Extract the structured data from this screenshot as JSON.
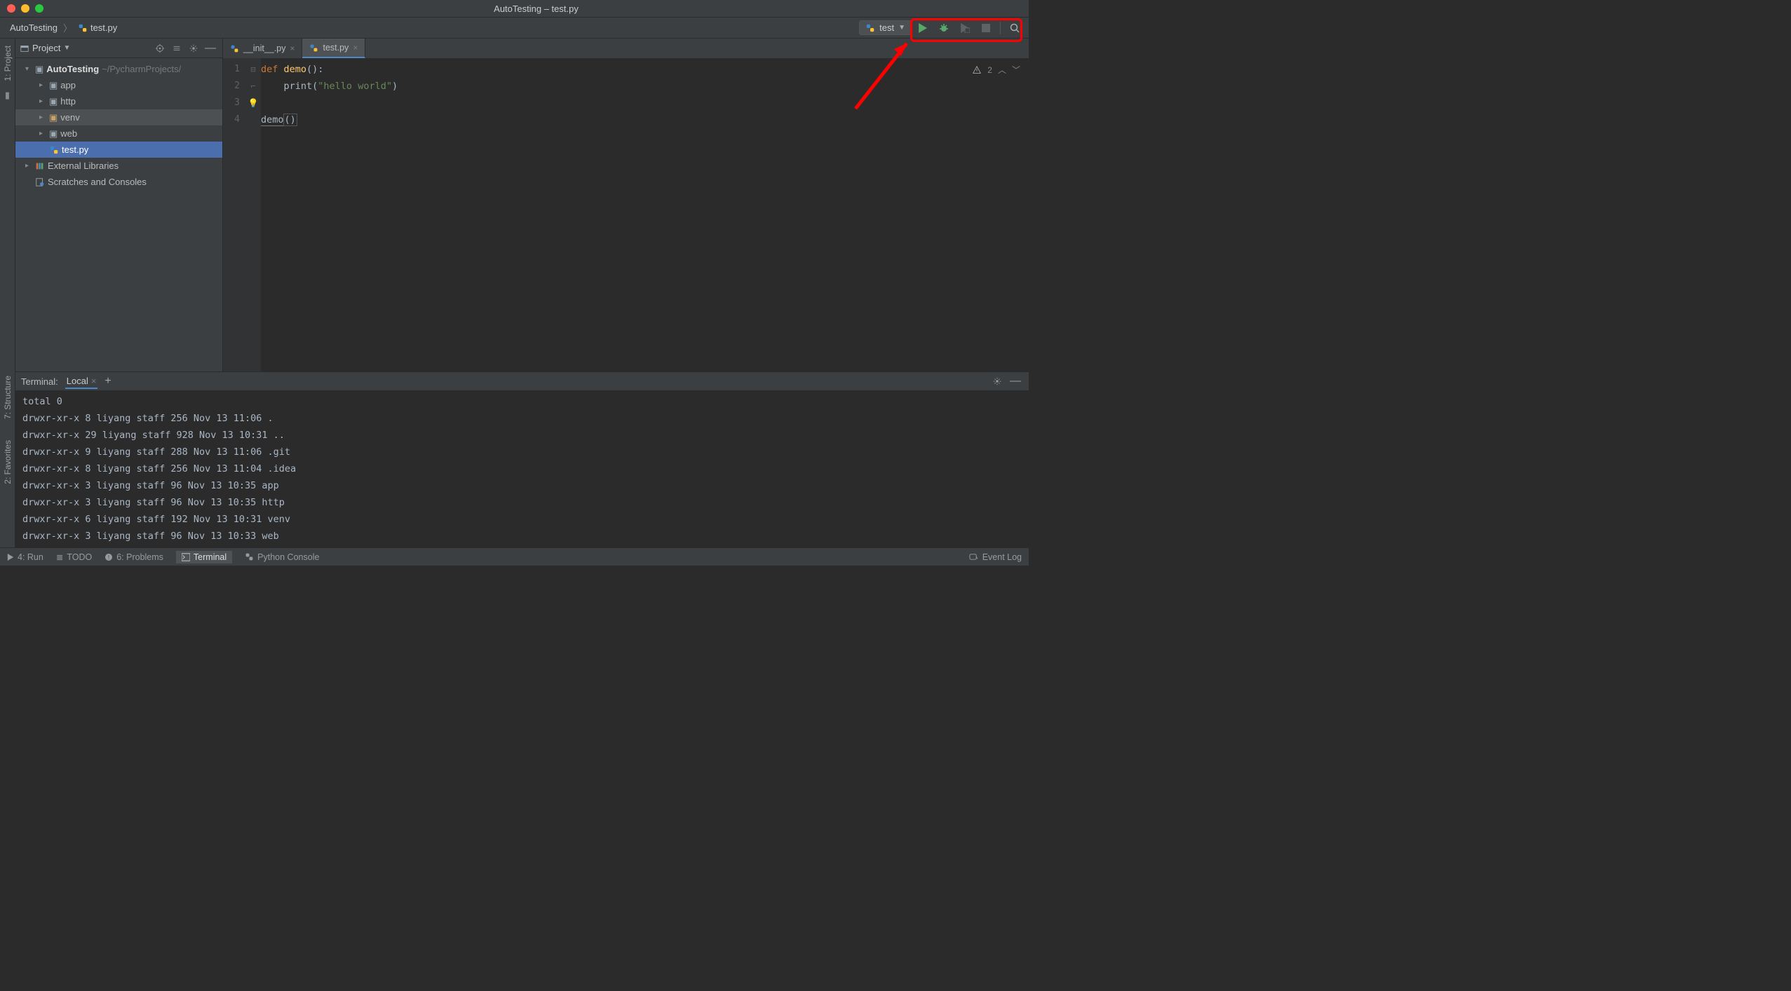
{
  "titlebar": {
    "title": "AutoTesting – test.py"
  },
  "breadcrumb": {
    "root": "AutoTesting",
    "file": "test.py"
  },
  "run_config": {
    "label": "test"
  },
  "sidebar": {
    "title": "Project",
    "tree": {
      "root_name": "AutoTesting",
      "root_path": "~/PycharmProjects/",
      "folders": [
        {
          "name": "app"
        },
        {
          "name": "http"
        },
        {
          "name": "venv"
        },
        {
          "name": "web"
        }
      ],
      "file": "test.py",
      "ext_libs": "External Libraries",
      "scratches": "Scratches and Consoles"
    }
  },
  "left_rail": {
    "project": "1: Project"
  },
  "left_rail2": {
    "structure": "7: Structure",
    "favorites": "2: Favorites"
  },
  "tabs": [
    {
      "label": "__init__.py",
      "active": false
    },
    {
      "label": "test.py",
      "active": true
    }
  ],
  "editor": {
    "line_numbers": [
      "1",
      "2",
      "3",
      "4"
    ],
    "code": {
      "l1": {
        "kw": "def ",
        "fn": "demo",
        "rest": "():"
      },
      "l2": {
        "indent": "    ",
        "call": "print",
        "open": "(",
        "str": "\"hello world\"",
        "close": ")"
      },
      "l3": "",
      "l4": {
        "call": "demo",
        "paren": "()"
      }
    },
    "inspection_count": "2"
  },
  "terminal": {
    "label": "Terminal:",
    "tab": "Local",
    "lines": [
      "total 0",
      "drwxr-xr-x   8 liyang  staff  256 Nov 13 11:06 .",
      "drwxr-xr-x  29 liyang  staff  928 Nov 13 10:31 ..",
      "drwxr-xr-x   9 liyang  staff  288 Nov 13 11:06 .git",
      "drwxr-xr-x   8 liyang  staff  256 Nov 13 11:04 .idea",
      "drwxr-xr-x   3 liyang  staff   96 Nov 13 10:35 app",
      "drwxr-xr-x   3 liyang  staff   96 Nov 13 10:35 http",
      "drwxr-xr-x   6 liyang  staff  192 Nov 13 10:31 venv",
      "drwxr-xr-x   3 liyang  staff   96 Nov 13 10:33 web"
    ]
  },
  "status": {
    "run": "4: Run",
    "todo": "TODO",
    "problems": "6: Problems",
    "terminal": "Terminal",
    "pyconsole": "Python Console",
    "eventlog": "Event Log"
  }
}
